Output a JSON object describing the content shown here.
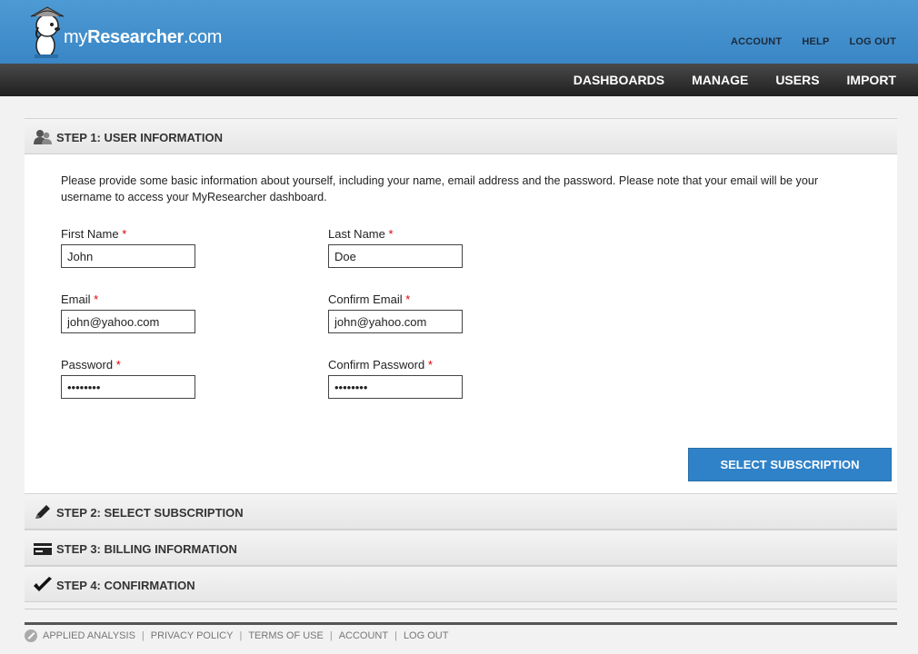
{
  "brand": {
    "name_prefix": "my",
    "name_main": "Researcher",
    "name_suffix": ".com"
  },
  "top_links": [
    "ACCOUNT",
    "HELP",
    "LOG OUT"
  ],
  "nav": [
    "DASHBOARDS",
    "MANAGE",
    "USERS",
    "IMPORT"
  ],
  "step1": {
    "title": "STEP 1: USER INFORMATION",
    "intro": "Please provide some basic information about yourself, including your name, email address and the password. Please note that your email will be your username to access your MyResearcher dashboard.",
    "required_mark": "*",
    "fields": {
      "first_name": {
        "label": "First Name",
        "value": "John"
      },
      "last_name": {
        "label": "Last Name",
        "value": "Doe"
      },
      "email": {
        "label": "Email",
        "value": "john@yahoo.com"
      },
      "confirm_email": {
        "label": "Confirm Email",
        "value": "john@yahoo.com"
      },
      "password": {
        "label": "Password",
        "value": "••••••••"
      },
      "confirm_password": {
        "label": "Confirm Password",
        "value": "••••••••"
      }
    },
    "button": "SELECT SUBSCRIPTION"
  },
  "step2": {
    "title": "STEP 2: SELECT SUBSCRIPTION"
  },
  "step3": {
    "title": "STEP 3: BILLING INFORMATION"
  },
  "step4": {
    "title": "STEP 4: CONFIRMATION"
  },
  "footer": [
    "APPLIED ANALYSIS",
    "PRIVACY POLICY",
    "TERMS OF USE",
    "ACCOUNT",
    "LOG OUT"
  ],
  "colors": {
    "header_blue": "#3a86c6",
    "nav_dark": "#2a2a2a",
    "button_blue": "#2f82c8",
    "required_red": "#dd0000"
  }
}
